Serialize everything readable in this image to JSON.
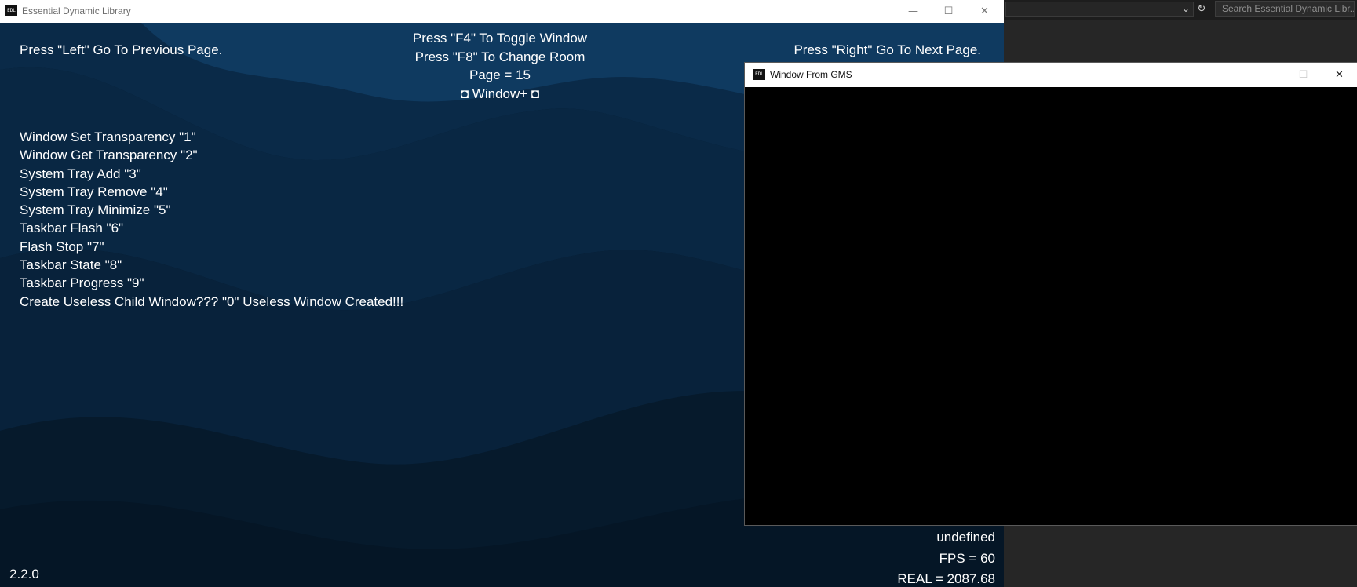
{
  "main_window": {
    "title": "Essential Dynamic Library",
    "icon_label": "EDL",
    "controls": {
      "minimize": "—",
      "maximize": "☐",
      "close": "✕"
    },
    "canvas": {
      "prev_hint": "Press \"Left\" Go To Previous Page.",
      "next_hint": "Press \"Right\" Go To Next Page.",
      "toggle_hint": "Press \"F4\" To Toggle Window",
      "room_hint": "Press \"F8\" To Change Room",
      "page_label": "Page = 15",
      "section_title": "◘ Window+ ◘",
      "menu_items": [
        "Window Set Transparency \"1\"",
        "Window Get Transparency \"2\"",
        "System Tray Add \"3\"",
        "System Tray Remove \"4\"",
        "System Tray Minimize \"5\"",
        "Taskbar Flash \"6\"",
        "Flash Stop \"7\"",
        "Taskbar State \"8\"",
        "Taskbar Progress \"9\"",
        "Create Useless Child Window??? \"0\"  Useless Window Created!!!"
      ],
      "status_undefined": "undefined",
      "fps": "FPS = 60",
      "real": "REAL = 2087.68",
      "version": "2.2.0"
    }
  },
  "child_window": {
    "title": "Window From GMS",
    "icon_label": "EDL",
    "controls": {
      "minimize": "—",
      "maximize": "☐",
      "close": "✕"
    }
  },
  "background_app": {
    "search_placeholder": "Search Essential Dynamic Libr...",
    "dropdown_icon": "chevron-down-icon",
    "refresh_icon": "refresh-icon"
  },
  "colors": {
    "canvas_dark": "#061a2c",
    "wave_mid": "#0a2a48",
    "wave_light": "#0f3a60",
    "text": "#ffffff",
    "titlebar": "#ffffff"
  }
}
